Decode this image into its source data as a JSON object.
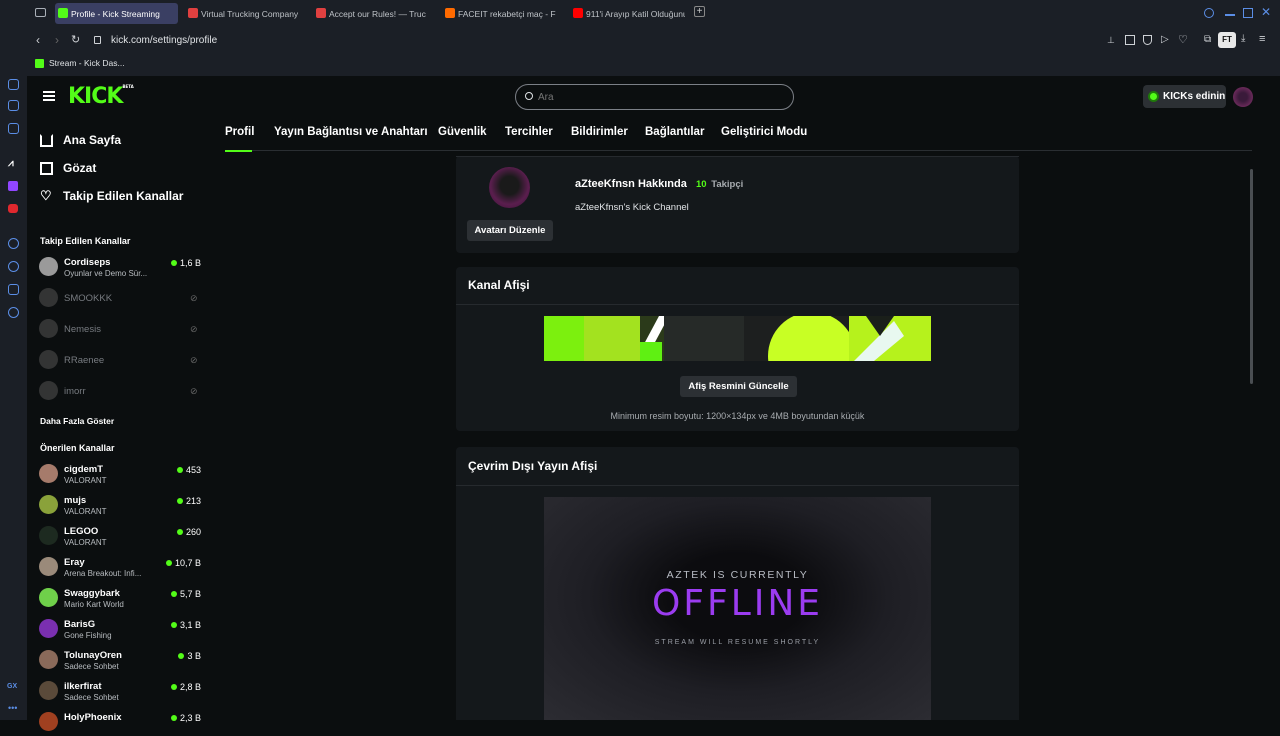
{
  "browser": {
    "tabs": [
      {
        "title": "Profile - Kick Streaming",
        "favicon_color": "#53fc18",
        "active": true
      },
      {
        "title": "Virtual Trucking Company",
        "favicon_color": "#e04040",
        "active": false
      },
      {
        "title": "Accept our Rules! — Truc",
        "favicon_color": "#e04040",
        "active": false
      },
      {
        "title": "FACEIT rekabetçi maç - F",
        "favicon_color": "#ff6a00",
        "active": false
      },
      {
        "title": "911'i Arayıp Katil Olduğunu",
        "favicon_color": "#ff0000",
        "active": false
      }
    ],
    "url": "kick.com/settings/profile",
    "bookmark": "Stream - Kick Das...",
    "profile_badge": "FT"
  },
  "header": {
    "logo": "KICK",
    "logo_tag": "BETA",
    "search_placeholder": "Ara",
    "kicks_button": "KICKs edinin"
  },
  "sidebar": {
    "nav": [
      {
        "label": "Ana Sayfa",
        "icon": "home-icon"
      },
      {
        "label": "Gözat",
        "icon": "browse-icon"
      },
      {
        "label": "Takip Edilen Kanallar",
        "icon": "heart-icon"
      }
    ],
    "followed_heading": "Takip Edilen Kanallar",
    "followed": [
      {
        "name": "Cordiseps",
        "sub": "Oyunlar ve Demo Sür...",
        "viewers": "1,6 B",
        "live": true
      },
      {
        "name": "SMOOKKK",
        "live": false
      },
      {
        "name": "Nemesis",
        "live": false
      },
      {
        "name": "RRaenee",
        "live": false
      },
      {
        "name": "imorr",
        "live": false
      }
    ],
    "show_more": "Daha Fazla Göster",
    "recommended_heading": "Önerilen Kanallar",
    "recommended": [
      {
        "name": "cigdemT",
        "sub": "VALORANT",
        "viewers": "453",
        "avatar": "#a67b6b"
      },
      {
        "name": "mujs",
        "sub": "VALORANT",
        "viewers": "213",
        "avatar": "#8aa23a"
      },
      {
        "name": "LEGOO",
        "sub": "VALORANT",
        "viewers": "260",
        "avatar": "#1d2a20"
      },
      {
        "name": "Eray",
        "sub": "Arena Breakout: Infi...",
        "viewers": "10,7 B",
        "avatar": "#9a8a7a"
      },
      {
        "name": "Swaggybark",
        "sub": "Mario Kart World",
        "viewers": "5,7 B",
        "avatar": "#6fd04a"
      },
      {
        "name": "BarisG",
        "sub": "Gone Fishing",
        "viewers": "3,1 B",
        "avatar": "#7a2fb0"
      },
      {
        "name": "TolunayOren",
        "sub": "Sadece Sohbet",
        "viewers": "3 B",
        "avatar": "#8a6a5a"
      },
      {
        "name": "ilkerfirat",
        "sub": "Sadece Sohbet",
        "viewers": "2,8 B",
        "avatar": "#5a4a3a"
      },
      {
        "name": "HolyPhoenix",
        "sub": "",
        "viewers": "2,3 B",
        "avatar": "#a04020"
      }
    ]
  },
  "settings_tabs": [
    "Profil",
    "Yayın Bağlantısı ve Anahtarı",
    "Güvenlik",
    "Tercihler",
    "Bildirimler",
    "Bağlantılar",
    "Geliştirici Modu"
  ],
  "profile": {
    "about_title": "aZteeKfnsn Hakkında",
    "followers_count": "10",
    "followers_label": "Takipçi",
    "bio": "aZteeKfnsn's Kick Channel",
    "edit_avatar": "Avatarı Düzenle"
  },
  "banner": {
    "title": "Kanal Afişi",
    "update_button": "Afiş Resmini Güncelle",
    "hint": "Minimum resim boyutu: 1200×134px ve 4MB boyutundan küçük"
  },
  "offline": {
    "title": "Çevrim Dışı Yayın Afişi",
    "line1": "AZTEK IS CURRENTLY",
    "line2": "OFFLINE",
    "line3": "STREAM WILL RESUME SHORTLY"
  },
  "colors": {
    "accent": "#53fc18",
    "purple": "#9b3cf0"
  }
}
